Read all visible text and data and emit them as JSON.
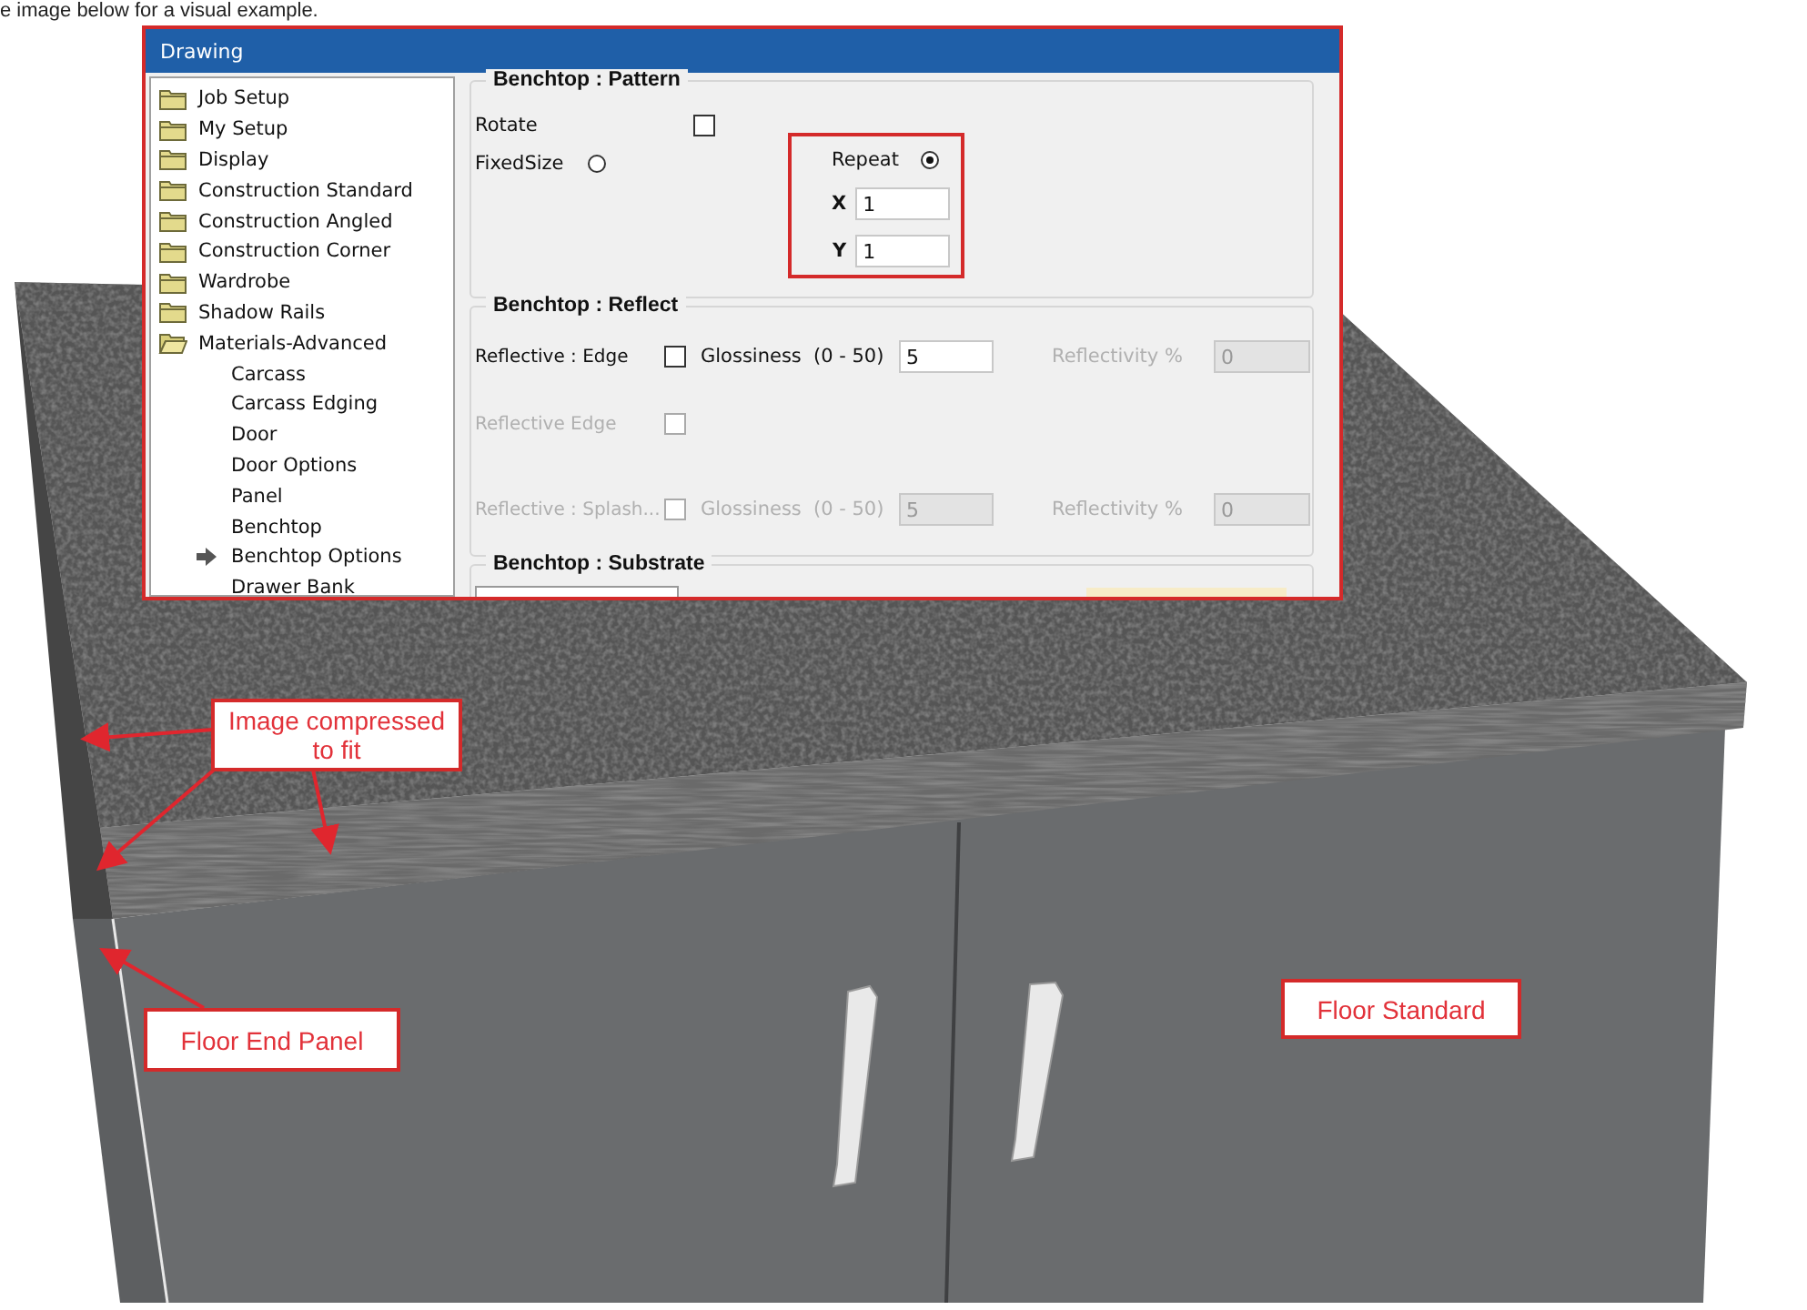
{
  "caption": "e image below for a visual example.",
  "dialog": {
    "title": "Drawing",
    "tree": [
      {
        "label": "Job Setup",
        "expanded": false
      },
      {
        "label": "My Setup",
        "expanded": false
      },
      {
        "label": "Display",
        "expanded": false
      },
      {
        "label": "Construction Standard",
        "expanded": false
      },
      {
        "label": "Construction Angled",
        "expanded": false
      },
      {
        "label": "Construction Corner",
        "expanded": false
      },
      {
        "label": "Wardrobe",
        "expanded": false
      },
      {
        "label": "Shadow Rails",
        "expanded": false
      },
      {
        "label": "Materials-Advanced",
        "expanded": true,
        "children": [
          {
            "label": "Carcass",
            "selected": false
          },
          {
            "label": "Carcass Edging",
            "selected": false
          },
          {
            "label": "Door",
            "selected": false
          },
          {
            "label": "Door Options",
            "selected": false
          },
          {
            "label": "Panel",
            "selected": false
          },
          {
            "label": "Benchtop",
            "selected": false
          },
          {
            "label": "Benchtop Options",
            "selected": true
          },
          {
            "label": "Drawer Bank",
            "selected": false
          }
        ]
      }
    ],
    "groups": [
      {
        "kind": "pattern",
        "title": "Benchtop : Pattern",
        "rotate": {
          "label": "Rotate",
          "checked": false
        },
        "fixed_size": {
          "label": "FixedSize",
          "selected": false
        },
        "repeat": {
          "label": "Repeat",
          "selected": true
        },
        "x": {
          "label": "X",
          "value": "1"
        },
        "y": {
          "label": "Y",
          "value": "1"
        }
      },
      {
        "kind": "reflect",
        "title": "Benchtop : Reflect",
        "rows": [
          {
            "label": "Reflective : Edge",
            "checked": false,
            "disabled": false,
            "glossiness": {
              "label": "Glossiness",
              "range": "(0 - 50)",
              "value": "5",
              "disabled": false
            },
            "reflectivity": {
              "label": "Reflectivity %",
              "value": "0",
              "disabled": true
            }
          },
          {
            "label": "Reflective Edge",
            "checked": false,
            "disabled": true
          },
          {
            "label": "Reflective : Splash...",
            "checked": false,
            "disabled": true,
            "glossiness": {
              "label": "Glossiness",
              "range": "(0 - 50)",
              "value": "5",
              "disabled": true
            },
            "reflectivity": {
              "label": "Reflectivity %",
              "value": "0",
              "disabled": true
            }
          }
        ]
      },
      {
        "kind": "substrate",
        "title": "Benchtop : Substrate"
      }
    ]
  },
  "annotations": [
    {
      "text": "Image compressed to fit"
    },
    {
      "text": "Floor End Panel"
    },
    {
      "text": "Floor Standard"
    }
  ]
}
